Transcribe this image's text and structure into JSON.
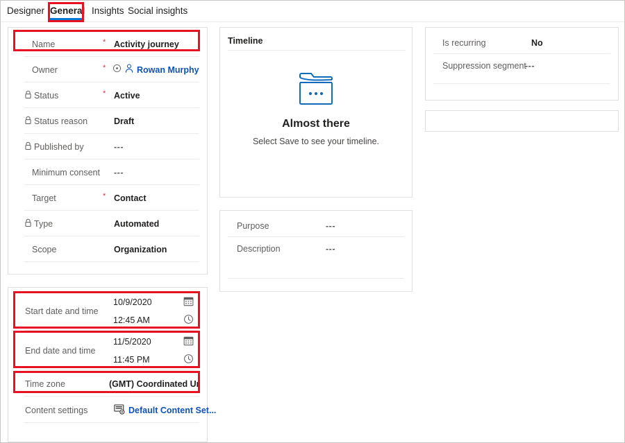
{
  "tabs": [
    {
      "label": "Designer",
      "selected": false
    },
    {
      "label": "General",
      "selected": true
    },
    {
      "label": "Insights",
      "selected": false
    },
    {
      "label": "Social insights",
      "selected": false
    }
  ],
  "colors": {
    "accent": "#0078d4",
    "callout": "#e81123",
    "required": "#d13438",
    "link": "#0f52ba",
    "card_border": "#e1dfdd",
    "divider": "#edebe9",
    "label": "#605e5c"
  },
  "left_card": {
    "fields": [
      {
        "label": "Name",
        "value": "Activity journey",
        "required": true,
        "locked": false,
        "icon": null,
        "highlighted": true
      },
      {
        "label": "Owner",
        "value": "Rowan Murphy",
        "required": true,
        "locked": false,
        "icon": "person-icon",
        "link": true,
        "presence": true
      },
      {
        "label": "Status",
        "value": "Active",
        "required": true,
        "locked": true
      },
      {
        "label": "Status reason",
        "value": "Draft",
        "required": false,
        "locked": true
      },
      {
        "label": "Published by",
        "value": "---",
        "required": false,
        "locked": true,
        "dim": true
      },
      {
        "label": "Minimum consent",
        "value": "---",
        "required": false,
        "locked": false,
        "dim": true
      },
      {
        "label": "Target",
        "value": "Contact",
        "required": true,
        "locked": false
      },
      {
        "label": "Type",
        "value": "Automated",
        "required": false,
        "locked": true
      },
      {
        "label": "Scope",
        "value": "Organization",
        "required": false,
        "locked": false
      }
    ]
  },
  "schedule_card": {
    "start": {
      "label": "Start date and time",
      "date": "10/9/2020",
      "time": "12:45 AM",
      "date_icon": "calendar-icon",
      "time_icon": "clock-icon",
      "highlighted": true
    },
    "end": {
      "label": "End date and time",
      "date": "11/5/2020",
      "time": "11:45 PM",
      "date_icon": "calendar-icon",
      "time_icon": "clock-icon",
      "highlighted": true
    },
    "timezone": {
      "label": "Time zone",
      "value": "(GMT) Coordinated Universal Time",
      "highlighted": true
    },
    "content_settings": {
      "label": "Content settings",
      "value": "Default Content Set...",
      "icon": "content-settings-icon",
      "link": true
    }
  },
  "timeline_card": {
    "title": "Timeline",
    "empty_icon": "timeline-folder-icon",
    "empty_heading": "Almost there",
    "empty_subtext": "Select Save to see your timeline."
  },
  "purpose_card": {
    "fields": [
      {
        "label": "Purpose",
        "value": "---"
      },
      {
        "label": "Description",
        "value": "---"
      }
    ]
  },
  "recurrence_card": {
    "fields": [
      {
        "label": "Is recurring",
        "value": "No",
        "dim": false
      },
      {
        "label": "Suppression segment",
        "value": "---",
        "dim": true
      }
    ]
  },
  "extra_card": {
    "content": ""
  }
}
